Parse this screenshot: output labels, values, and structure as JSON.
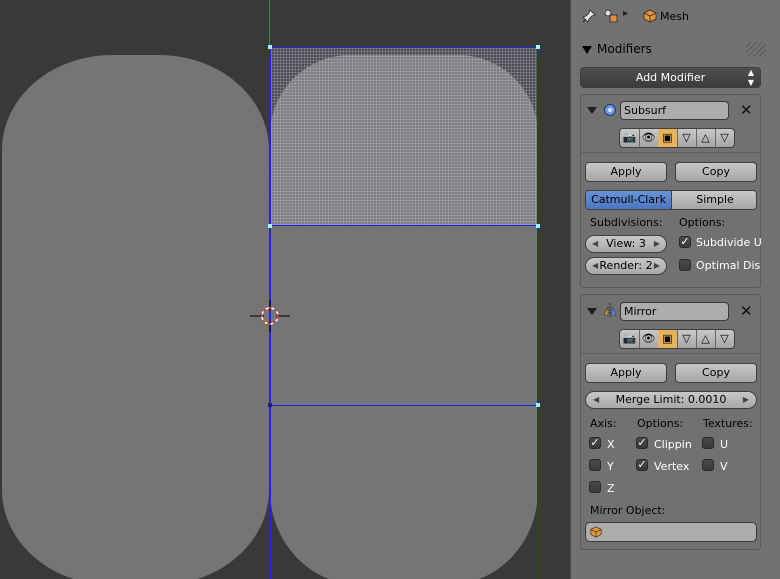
{
  "header": {
    "context": "Mesh",
    "icons": [
      "pin-icon",
      "object-data-icon",
      "chevron-right-icon",
      "mesh-cube-icon"
    ]
  },
  "panel": {
    "title": "Modifiers",
    "add_modifier": "Add Modifier"
  },
  "subsurf": {
    "name": "Subsurf",
    "apply": "Apply",
    "copy": "Copy",
    "types": [
      "Catmull-Clark",
      "Simple"
    ],
    "selected_type": "Catmull-Clark",
    "subdivisions_label": "Subdivisions:",
    "options_label": "Options:",
    "view": "View: 3",
    "render": "Render: 2",
    "opt_subdivide_uv": "Subdivide U",
    "opt_subdivide_uv_checked": true,
    "opt_optimal": "Optimal Dis",
    "opt_optimal_checked": false
  },
  "mirror": {
    "name": "Mirror",
    "apply": "Apply",
    "copy": "Copy",
    "merge_limit": "Merge Limit: 0.0010",
    "axis_label": "Axis:",
    "options_label": "Options:",
    "textures_label": "Textures:",
    "axis_x": "X",
    "axis_x_checked": true,
    "axis_y": "Y",
    "axis_y_checked": false,
    "axis_z": "Z",
    "axis_z_checked": false,
    "opt_clipping": "Clippin",
    "opt_clipping_checked": true,
    "opt_vertex": "Vertex",
    "opt_vertex_checked": true,
    "tex_u": "U",
    "tex_u_checked": false,
    "tex_v": "V",
    "tex_v_checked": false,
    "mirror_object_label": "Mirror Object:",
    "mirror_object_value": ""
  },
  "colors": {
    "viewport_bg": "#393939",
    "mesh": "#757578",
    "edge": "#2525d6",
    "accent": "#5680c2"
  }
}
